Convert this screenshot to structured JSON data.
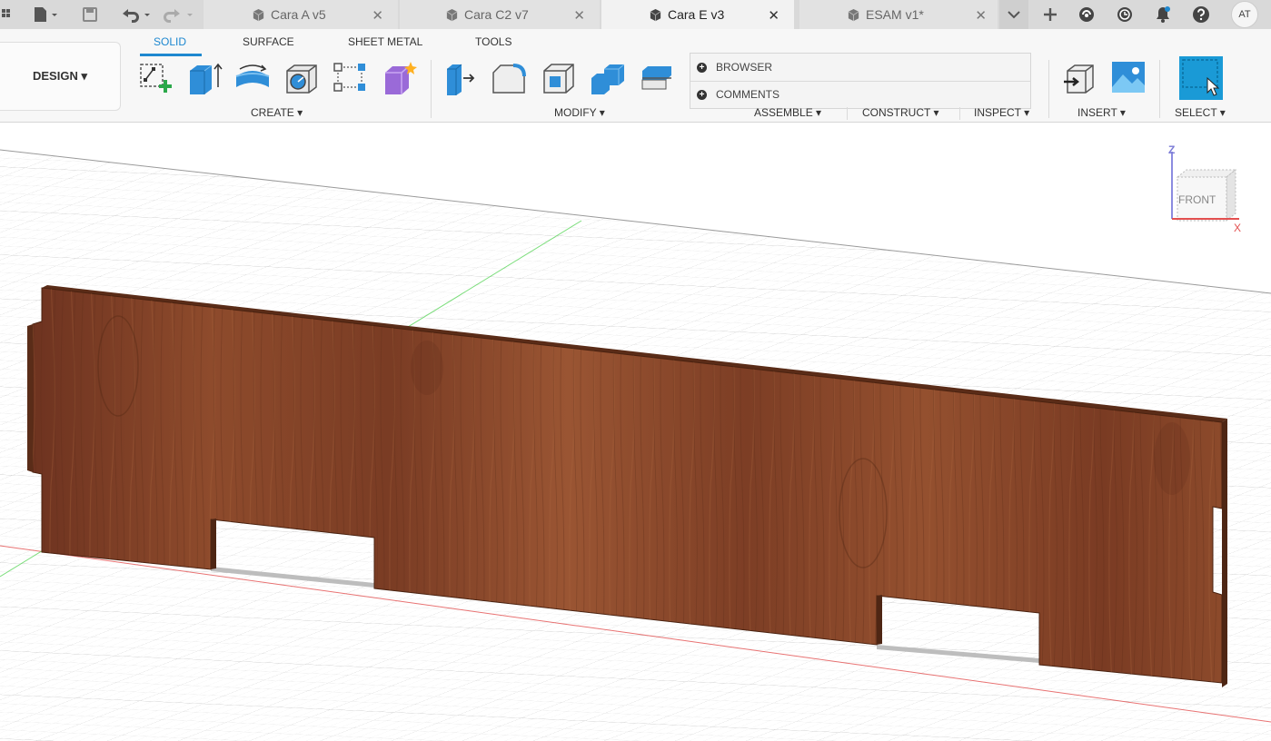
{
  "tabbar": {
    "tabs": [
      {
        "label": "Cara A v5",
        "active": false
      },
      {
        "label": "Cara C2 v7",
        "active": false
      },
      {
        "label": "Cara E v3",
        "active": true
      },
      {
        "label": "ESAM v1*",
        "active": false
      }
    ],
    "close_glyph": "✕",
    "user_initials": "AT"
  },
  "ribbon": {
    "workspace": "DESIGN ▾",
    "tabs": [
      "SOLID",
      "SURFACE",
      "SHEET METAL",
      "TOOLS"
    ],
    "groups": {
      "create": "CREATE ▾",
      "modify": "MODIFY ▾",
      "assemble": "ASSEMBLE ▾",
      "construct": "CONSTRUCT ▾",
      "inspect": "INSPECT ▾",
      "insert": "INSERT ▾",
      "select": "SELECT ▾"
    },
    "panel": {
      "browser": "BROWSER",
      "comments": "COMMENTS"
    }
  },
  "viewcube": {
    "face": "FRONT",
    "axis_z": "Z",
    "axis_x": "X"
  },
  "colors": {
    "accent": "#1e88d0",
    "wood": "#8a4a2c",
    "wood_edge": "#5a2c18",
    "x_axis": "#e35050",
    "y_axis": "#5cd65c",
    "select_tool": "#1a9ad6"
  }
}
